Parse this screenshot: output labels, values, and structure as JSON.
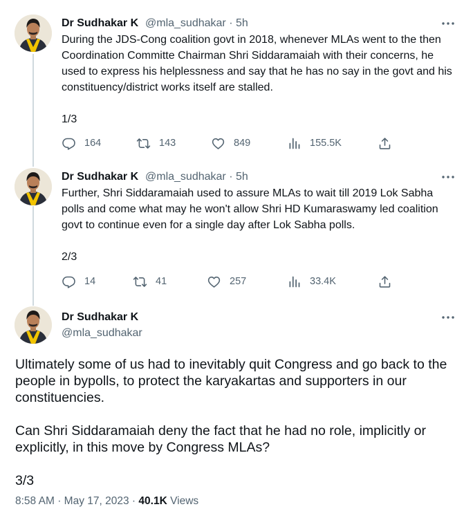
{
  "tweets": [
    {
      "name": "Dr Sudhakar K",
      "handle": "@mla_sudhakar",
      "sep": "·",
      "time": "5h",
      "text": "During the JDS-Cong coalition govt in 2018, whenever MLAs went to the then Coordination Committe Chairman Shri Siddaramaiah with their concerns, he used to express his helplessness and say that he has no say in the govt and his constituency/district works itself are stalled.\n\n1/3",
      "replies": "164",
      "retweets": "143",
      "likes": "849",
      "views": "155.5K"
    },
    {
      "name": "Dr Sudhakar K",
      "handle": "@mla_sudhakar",
      "sep": "·",
      "time": "5h",
      "text": "Further, Shri Siddaramaiah used to assure MLAs to wait till 2019 Lok Sabha polls and come what may he won't allow Shri HD Kumaraswamy led coalition govt to continue even for a single day after Lok Sabha polls.\n\n2/3",
      "replies": "14",
      "retweets": "41",
      "likes": "257",
      "views": "33.4K"
    }
  ],
  "main": {
    "name": "Dr Sudhakar K",
    "handle": "@mla_sudhakar",
    "text": "Ultimately some of us had to inevitably quit Congress and go back to the people in bypolls, to protect the karyakartas and supporters in our constituencies.\n\nCan Shri Siddaramaiah deny the fact that he had no role, implicitly or explicitly, in this move by Congress MLAs?\n\n3/3",
    "time": "8:58 AM",
    "sep1": "·",
    "date": "May 17, 2023",
    "sep2": "·",
    "views_count": "40.1K",
    "views_label": "Views"
  },
  "icons": {
    "reply": "reply-icon",
    "retweet": "retweet-icon",
    "like": "heart-icon",
    "views": "views-icon",
    "share": "share-icon",
    "more": "more-icon"
  },
  "colors": {
    "text": "#0f1419",
    "secondary": "#536471",
    "thread_line": "#cfd9de",
    "scarf": "#f2c400"
  }
}
